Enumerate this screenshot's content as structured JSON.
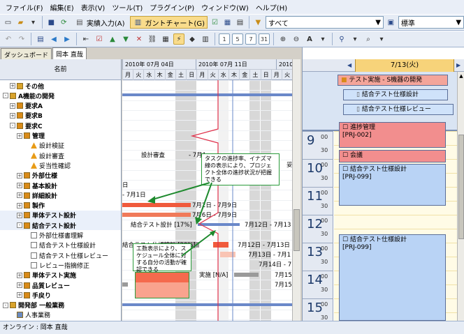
{
  "menubar": [
    "ファイル(F)",
    "編集(E)",
    "表示(V)",
    "ツール(T)",
    "プラグイン(P)",
    "ウィンドウ(W)",
    "ヘルプ(H)"
  ],
  "toolbar": {
    "actual_input": "実績入力(A)",
    "gantt_chart": "ガントチャート(G)",
    "filter_all": "すべて",
    "view_standard": "標準",
    "zoom_buttons": [
      "1",
      "5",
      "7",
      "31"
    ]
  },
  "tabs": [
    "ダッシュボード",
    "岡本 直哉"
  ],
  "tree": {
    "header": "名前",
    "rows": [
      {
        "label": "その他",
        "indent": 1,
        "expander": "+",
        "icon": "folder"
      },
      {
        "label": "A機能の開発",
        "indent": 0,
        "expander": "-",
        "icon": "folder"
      },
      {
        "label": "要求A",
        "indent": 1,
        "expander": "+",
        "icon": "box"
      },
      {
        "label": "要求B",
        "indent": 1,
        "expander": "+",
        "icon": "box"
      },
      {
        "label": "要求C",
        "indent": 1,
        "expander": "-",
        "icon": "box"
      },
      {
        "label": "管理",
        "indent": 2,
        "expander": "+",
        "icon": "box"
      },
      {
        "label": "設計検証",
        "indent": 3,
        "expander": "",
        "icon": "warn"
      },
      {
        "label": "設計審査",
        "indent": 3,
        "expander": "",
        "icon": "warn"
      },
      {
        "label": "妥当性確認",
        "indent": 3,
        "expander": "",
        "icon": "warn"
      },
      {
        "label": "外部仕様",
        "indent": 2,
        "expander": "+",
        "icon": "box"
      },
      {
        "label": "基本設計",
        "indent": 2,
        "expander": "+",
        "icon": "box"
      },
      {
        "label": "詳細設計",
        "indent": 2,
        "expander": "+",
        "icon": "box"
      },
      {
        "label": "製作",
        "indent": 2,
        "expander": "+",
        "icon": "box"
      },
      {
        "label": "単体テスト設計",
        "indent": 2,
        "expander": "+",
        "icon": "box"
      },
      {
        "label": "結合テスト設計",
        "indent": 2,
        "expander": "-",
        "icon": "box"
      },
      {
        "label": "外部仕様書理解",
        "indent": 3,
        "expander": "",
        "icon": "doc"
      },
      {
        "label": "結合テスト仕様設計",
        "indent": 3,
        "expander": "",
        "icon": "doc"
      },
      {
        "label": "結合テスト仕様レビュー",
        "indent": 3,
        "expander": "",
        "icon": "doc"
      },
      {
        "label": "レビュー指摘修正",
        "indent": 3,
        "expander": "",
        "icon": "doc"
      },
      {
        "label": "単体テスト実施",
        "indent": 2,
        "expander": "+",
        "icon": "box"
      },
      {
        "label": "品質レビュー",
        "indent": 2,
        "expander": "+",
        "icon": "box"
      },
      {
        "label": "手戻り",
        "indent": 2,
        "expander": "+",
        "icon": "box"
      },
      {
        "label": "開発部 一般業務",
        "indent": 0,
        "expander": "-",
        "icon": "folder"
      },
      {
        "label": "人事業務",
        "indent": 1,
        "expander": "",
        "icon": "person"
      }
    ]
  },
  "gantt": {
    "weeks": [
      "2010年 07月 04日",
      "2010年 07月 11日",
      "2010"
    ],
    "days": [
      "月",
      "火",
      "水",
      "木",
      "金",
      "土",
      "日",
      "月",
      "火",
      "水",
      "木",
      "金",
      "土",
      "日",
      "月",
      "火"
    ],
    "labels": [
      {
        "text": "設計審査",
        "row": 7,
        "offset": 27
      },
      {
        "text": "- 7月1",
        "row": 7,
        "offset": 95
      },
      {
        "text": "妥",
        "row": 8,
        "offset": 235
      },
      {
        "text": "日",
        "row": 10,
        "offset": 0
      },
      {
        "text": "- 7月1日",
        "row": 11,
        "offset": 0
      },
      {
        "text": "7月2日 - 7月9日",
        "row": 12,
        "offset": 100
      },
      {
        "text": "7月6日 - 7月9日",
        "row": 13,
        "offset": 100
      },
      {
        "text": "結合テスト設計 [17%]",
        "row": 14,
        "offset": 12
      },
      {
        "text": "7月12日 - 7月13",
        "row": 14,
        "offset": 175
      },
      {
        "text": "結合テスト仕様設計 [20%]",
        "row": 16,
        "offset": 0
      },
      {
        "text": "7月12日 - 7月13日",
        "row": 16,
        "offset": 165
      },
      {
        "text": "7月13日 - 7月1",
        "row": 17,
        "offset": 180
      },
      {
        "text": "7月14日 - 7",
        "row": 18,
        "offset": 195
      },
      {
        "text": "実施 [N/A]",
        "row": 19,
        "offset": 110
      },
      {
        "text": "7月15",
        "row": 19,
        "offset": 218
      },
      {
        "text": "7月15",
        "row": 20,
        "offset": 218
      }
    ]
  },
  "callouts": [
    "タスクの進捗率、イナズマ線の表示により、プロジェクト全体の進捗状況が把握できる",
    "工数表示により、スケジュール全体に対する自分の活動が確認できる"
  ],
  "calendar": {
    "date": "7/13(火)",
    "allday": [
      {
        "label": "テスト実施 - S機器の開発",
        "color": "#f4a59a"
      },
      {
        "label": "結合テスト仕様設計",
        "color": "#cfe2fa"
      },
      {
        "label": "結合テスト仕様レビュー",
        "color": "#cfe2fa"
      }
    ],
    "hours": [
      "9",
      "10",
      "11",
      "12",
      "13",
      "14",
      "15"
    ],
    "minutes": [
      "00",
      "30"
    ],
    "appointments": [
      {
        "title": "進捗管理",
        "code": "[PRJ-002]",
        "color": "#f28e8e"
      },
      {
        "title": "会議",
        "code": "",
        "color": "#f28e8e"
      },
      {
        "title": "結合テスト仕様設計",
        "code": "[PRJ-099]",
        "color": "#b9d3f5"
      },
      {
        "title": "結合テスト仕様設計",
        "code": "[PRJ-099]",
        "color": "#b9d3f5"
      }
    ]
  },
  "status": "オンライン : 岡本 直哉"
}
